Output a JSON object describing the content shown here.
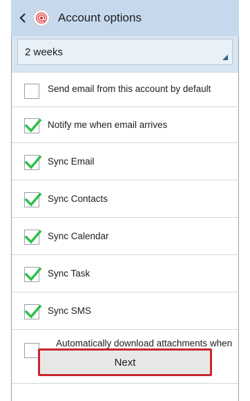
{
  "action_bar": {
    "title": "Account options",
    "back_icon": "chevron-left-icon",
    "app_icon": "email-at-icon"
  },
  "sync_period": {
    "selected": "2 weeks"
  },
  "options": [
    {
      "label": "Send email from this account by default",
      "checked": false
    },
    {
      "label": "Notify me when email arrives",
      "checked": true
    },
    {
      "label": "Sync Email",
      "checked": true
    },
    {
      "label": "Sync Contacts",
      "checked": true
    },
    {
      "label": "Sync Calendar",
      "checked": true
    },
    {
      "label": "Sync Task",
      "checked": true
    },
    {
      "label": "Sync SMS",
      "checked": true
    },
    {
      "label": "Automatically download attachments when connected to Wi-Fi",
      "checked": false
    }
  ],
  "next_button": {
    "label": "Next"
  },
  "colors": {
    "check": "#2fbf4a",
    "highlight_border": "#c9242b",
    "action_bar": "#c6d8ec"
  }
}
